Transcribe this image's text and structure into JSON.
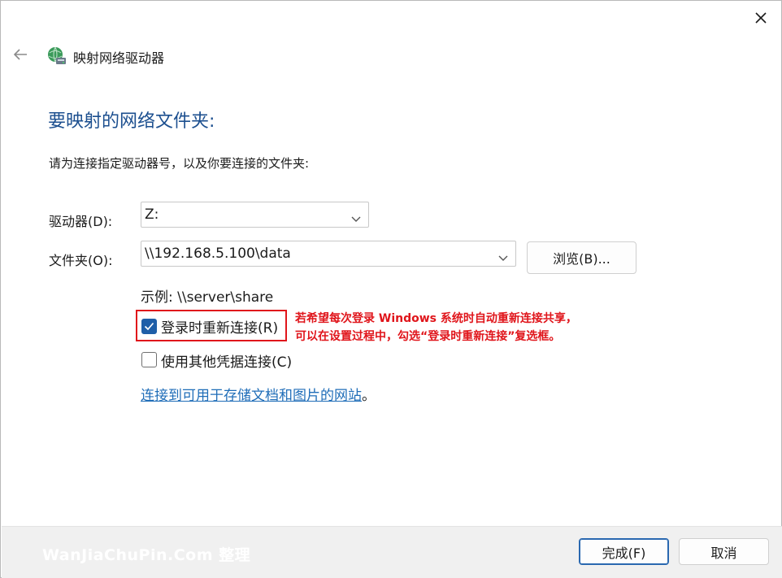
{
  "window": {
    "title": "映射网络驱动器",
    "close_glyph": "✕",
    "back_glyph": "←"
  },
  "main": {
    "heading": "要映射的网络文件夹:",
    "instruction": "请为连接指定驱动器号，以及你要连接的文件夹:",
    "drive_label": "驱动器(D):",
    "drive_value": "Z:",
    "folder_label": "文件夹(O):",
    "folder_value": "\\\\192.168.5.100\\data",
    "browse_label": "浏览(B)...",
    "example": "示例: \\\\server\\share",
    "reconnect_label": "登录时重新连接(R)",
    "reconnect_checked": true,
    "other_credentials_label": "使用其他凭据连接(C)",
    "other_credentials_checked": false,
    "link_text": "连接到可用于存储文档和图片的网站",
    "link_suffix": "。"
  },
  "annotation": {
    "line1": "若希望每次登录 Windows 系统时自动重新连接共享，",
    "line2": "可以在设置过程中，勾选“登录时重新连接”复选框。",
    "color": "#e0151b"
  },
  "footer": {
    "watermark": "WanJiaChuPin.Com 整理",
    "finish_label": "完成(F)",
    "cancel_label": "取消"
  },
  "colors": {
    "heading": "#1c4f8f",
    "link": "#1f6db8",
    "checkbox_accent": "#1f5fa8"
  }
}
